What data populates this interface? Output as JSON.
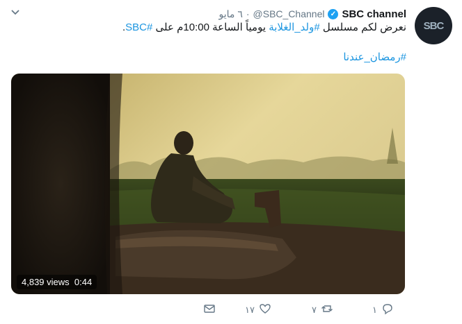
{
  "tweet": {
    "display_name": "SBC channel",
    "handle": "@SBC_Channel",
    "separator": "·",
    "time": "٦ مايو",
    "avatar_text": "SBC",
    "text_prefix": "نعرض لكم مسلسل ",
    "hashtag_series": "#ولد_الغلابة",
    "text_middle": " يومياً الساعة 10:00م على ",
    "hashtag_channel": "#SBC",
    "text_suffix": ".",
    "hashtag_ramadan": "#رمضان_عندنا"
  },
  "media": {
    "views": "4,839 views",
    "duration": "0:44"
  },
  "actions": {
    "reply_count": "١",
    "retweet_count": "٧",
    "like_count": "١٧",
    "reply_icon": "reply-icon",
    "retweet_icon": "retweet-icon",
    "like_icon": "heart-icon",
    "message_icon": "message-icon"
  },
  "colors": {
    "link": "#1b95e0",
    "verified": "#1da1f2",
    "muted": "#657786"
  }
}
